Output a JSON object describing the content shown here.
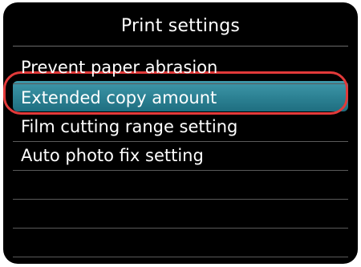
{
  "header": {
    "title": "Print settings"
  },
  "menu": {
    "items": [
      {
        "label": "Prevent paper abrasion",
        "selected": false
      },
      {
        "label": "Extended copy amount",
        "selected": true
      },
      {
        "label": "Film cutting range setting",
        "selected": false
      },
      {
        "label": "Auto photo fix setting",
        "selected": false
      },
      {
        "label": "",
        "selected": false
      },
      {
        "label": "",
        "selected": false
      },
      {
        "label": "",
        "selected": false
      }
    ]
  },
  "colors": {
    "background": "#000000",
    "text": "#ffffff",
    "selection": "#2c8193",
    "callout_ring": "#e23a3a"
  }
}
